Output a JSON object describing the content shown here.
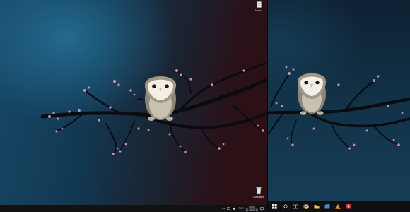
{
  "desktop": {
    "icons": [
      {
        "name": "games-folder",
        "label": "Игры"
      },
      {
        "name": "recycle-bin",
        "label": "Корзина"
      }
    ]
  },
  "taskbar_left": {
    "tray": {
      "language": "РУС",
      "time": "13:45",
      "date": "21.09.2016"
    }
  },
  "taskbar_right": {
    "items": [
      "windows-start-icon",
      "search-icon",
      "task-view-icon",
      "chrome-icon",
      "file-explorer-icon",
      "store-icon",
      "vlc-icon",
      "media-player-icon"
    ]
  },
  "colors": {
    "wallpaper_blue": "#174766",
    "wallpaper_red": "#2e0f12",
    "blossom": "#c98bb8",
    "owl_face": "#f2efe6",
    "owl_body": "#8d8478",
    "taskbar": "#101214"
  }
}
